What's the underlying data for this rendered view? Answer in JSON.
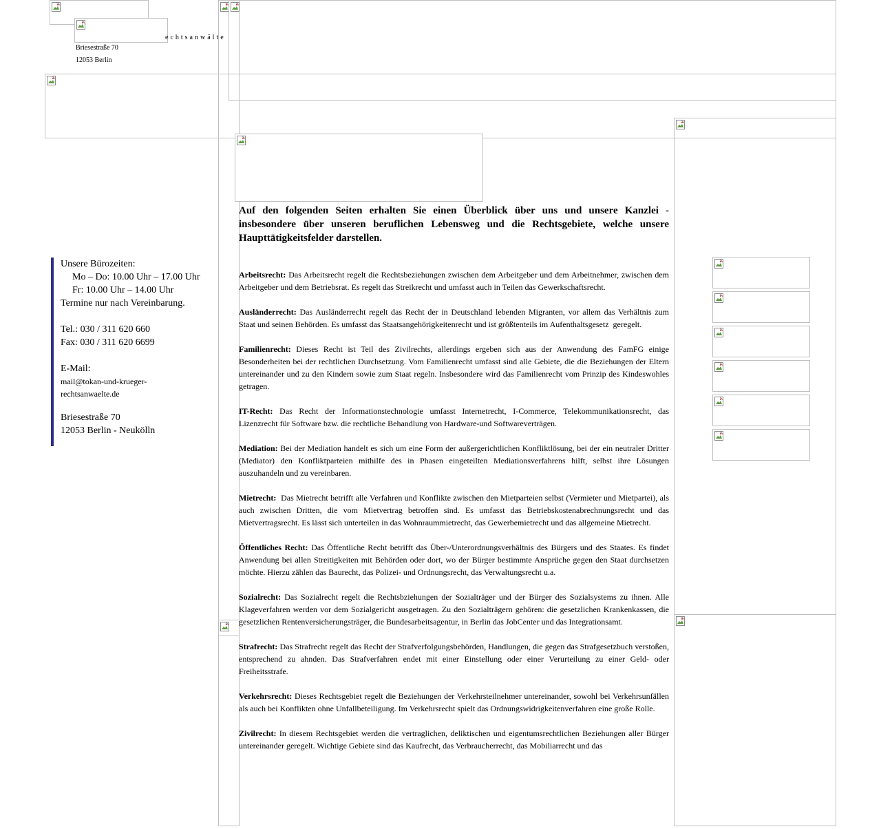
{
  "header": {
    "tagline": "echtsanwälte",
    "address_street": "Briesestraße 70",
    "address_city": "12053 Berlin"
  },
  "sidebar": {
    "hours_title": "Unsere Bürozeiten:",
    "hours_mo_do": "Mo – Do: 10.00 Uhr – 17.00 Uhr",
    "hours_fr": "Fr: 10.00 Uhr – 14.00 Uhr",
    "appointment_note": "Termine nur nach Vereinbarung.",
    "tel": "Tel.: 030 / 311 620 660",
    "fax": "Fax: 030 / 311 620 6699",
    "email_label": "E-Mail:",
    "email_line1": "mail@tokan-und-krueger-",
    "email_line2": "rechtsanwaelte.de",
    "street": "Briesestraße 70",
    "city": "12053 Berlin - Neukölln"
  },
  "main": {
    "intro": "Auf den folgenden Seiten erhalten Sie einen Überblick über uns und unsere Kanzlei - insbesondere über unseren beruflichen Lebensweg und die Rechtsgebiete, welche unsere Haupttätigkeitsfelder darstellen.",
    "entries": [
      {
        "term": "Arbeitsrecht:",
        "text": " Das Arbeitsrecht regelt die Rechtsbeziehungen zwischen dem Arbeitgeber und dem Arbeitnehmer, zwischen dem Arbeitgeber und dem Betriebsrat. Es regelt das Streikrecht und umfasst auch in Teilen das Gewerkschaftsrecht."
      },
      {
        "term": "Ausländerrecht:",
        "text": " Das Ausländerrecht regelt das Recht der in Deutschland lebenden Migranten, vor allem das Verhältnis zum Staat und seinen Behörden. Es umfasst das Staatsangehörigkeitenrecht und ist größtenteils im Aufenthaltsgesetz  geregelt."
      },
      {
        "term": "Familienrecht:",
        "text": " Dieses Recht ist Teil des Zivilrechts, allerdings ergeben sich aus der Anwendung des FamFG einige Besonderheiten bei der rechtlichen Durchsetzung. Vom Familienrecht umfasst sind alle Gebiete, die die Beziehungen der Eltern untereinander und zu den Kindern sowie zum Staat regeln. Insbesondere wird das Familienrecht vom Prinzip des Kindeswohles getragen."
      },
      {
        "term": "IT-Recht:",
        "text": " Das Recht der Informationstechnologie umfasst Internetrecht, I-Commerce, Telekommunikationsrecht, das Lizenzrecht für Software bzw. die rechtliche Behandlung von Hardware-und Softwareverträgen."
      },
      {
        "term": "Mediation:",
        "text": " Bei der Mediation handelt es sich um eine Form der außergerichtlichen Konfliktlösung, bei der ein neutraler Dritter (Mediator) den Konfliktparteien mithilfe des in Phasen eingeteilten Mediationsverfahrens hilft, selbst ihre Lösungen auszuhandeln und zu vereinbaren."
      },
      {
        "term": "Mietrecht:",
        "text": "  Das Mietrecht betrifft alle Verfahren und Konflikte zwischen den Mietparteien selbst (Vermieter und Mietpartei), als auch zwischen Dritten, die vom Mietvertrag betroffen sind. Es umfasst das Betriebskostenabrechnungsrecht und das Mietvertragsrecht. Es lässt sich unterteilen in das Wohnraummietrecht, das Gewerbemietrecht und das allgemeine Mietrecht."
      },
      {
        "term": "Öffentliches Recht:",
        "text": " Das Öffentliche Recht betrifft das Über-/Unterordnungsverhältnis des Bürgers und des Staates. Es findet Anwendung bei allen Streitigkeiten mit Behörden oder dort, wo der Bürger bestimmte Ansprüche gegen den Staat durchsetzen möchte. Hierzu zählen das Baurecht, das Polizei- und Ordnungsrecht, das Verwaltungsrecht u.a."
      },
      {
        "term": "Sozialrecht:",
        "text": " Das Sozialrecht regelt die Rechtsbziehungen der Sozialträger und der Bürger des Sozialsystems zu ihnen. Alle Klageverfahren werden vor dem Sozialgericht ausgetragen. Zu den Sozialträgern gehören: die gesetzlichen Krankenkassen, die gesetzlichen Rentenversicherungsträger, die Bundesarbeitsagentur, in Berlin das JobCenter und das Integrationsamt."
      },
      {
        "term": "Strafrecht:",
        "text": " Das Strafrecht regelt das Recht der Strafverfolgungsbehörden, Handlungen, die gegen das Strafgesetzbuch verstoßen, entsprechend zu ahnden. Das Strafverfahren endet mit einer Einstellung oder einer Verurteilung zu einer Geld- oder Freiheitsstrafe."
      },
      {
        "term": "Verkehrsrecht:",
        "text": " Dieses Rechtsgebiet regelt die Beziehungen der Verkehrsteilnehmer untereinander, sowohl bei Verkehrsunfällen als auch bei Konflikten ohne Unfallbeteiligung. Im Verkehrsrecht spielt das Ordnungswidrigkeitenverfahren eine große Rolle."
      },
      {
        "term": "Zivilrecht:",
        "text": " In diesem Rechtsgebiet werden die vertraglichen, deliktischen und eigentumsrechtlichen Beziehungen aller Bürger untereinander geregelt. Wichtige Gebiete sind das Kaufrecht, das Verbraucherrecht, das Mobiliarrecht und das"
      }
    ]
  },
  "icons": {
    "broken_image": "broken-image-icon"
  }
}
